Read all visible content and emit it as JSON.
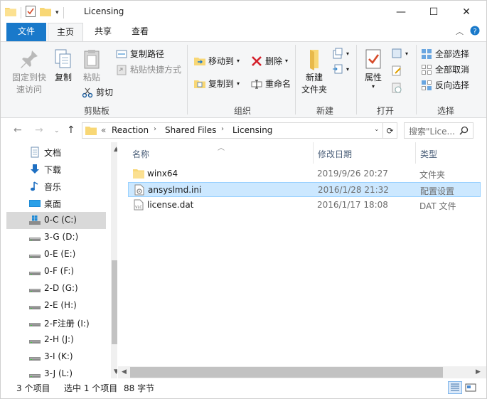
{
  "window": {
    "title": "Licensing",
    "controls": {
      "minimize": "—",
      "maximize": "☐",
      "close": "✕"
    }
  },
  "ribbon_tabs": [
    {
      "label": "文件"
    },
    {
      "label": "主页"
    },
    {
      "label": "共享"
    },
    {
      "label": "查看"
    }
  ],
  "ribbon": {
    "clipboard": {
      "pin_label": "固定到快\n速访问",
      "copy_label": "复制",
      "paste_label": "粘贴",
      "copy_path_label": "复制路径",
      "paste_shortcut_label": "粘贴快捷方式",
      "cut_label": "剪切",
      "group_label": "剪贴板"
    },
    "organize": {
      "move_to_label": "移动到",
      "copy_to_label": "复制到",
      "delete_label": "删除",
      "rename_label": "重命名",
      "group_label": "组织"
    },
    "new": {
      "new_folder_label": "新建\n文件夹",
      "group_label": "新建"
    },
    "open": {
      "properties_label": "属性",
      "group_label": "打开"
    },
    "select": {
      "select_all_label": "全部选择",
      "select_none_label": "全部取消",
      "invert_label": "反向选择",
      "group_label": "选择"
    }
  },
  "address": {
    "prefix": "«",
    "crumbs": [
      "Reaction",
      "Shared Files",
      "Licensing"
    ],
    "search_placeholder": "搜索\"Lice..."
  },
  "nav_pane": {
    "items": [
      {
        "label": "文档",
        "icon": "documents-icon"
      },
      {
        "label": "下载",
        "icon": "download-icon"
      },
      {
        "label": "音乐",
        "icon": "music-icon"
      },
      {
        "label": "桌面",
        "icon": "desktop-icon"
      },
      {
        "label": "0-C (C:)",
        "icon": "windows-drive-icon",
        "selected": true
      },
      {
        "label": "3-G (D:)",
        "icon": "drive-icon"
      },
      {
        "label": "0-E (E:)",
        "icon": "drive-icon"
      },
      {
        "label": "0-F (F:)",
        "icon": "drive-icon"
      },
      {
        "label": "2-D (G:)",
        "icon": "drive-icon"
      },
      {
        "label": "2-E (H:)",
        "icon": "drive-icon"
      },
      {
        "label": "2-F注册 (I:)",
        "icon": "drive-icon"
      },
      {
        "label": "2-H (J:)",
        "icon": "drive-icon"
      },
      {
        "label": "3-I (K:)",
        "icon": "drive-icon"
      },
      {
        "label": "3-J (L:)",
        "icon": "drive-icon"
      }
    ]
  },
  "file_list": {
    "columns": {
      "name": "名称",
      "date": "修改日期",
      "type": "类型"
    },
    "rows": [
      {
        "name": "winx64",
        "date": "2019/9/26 20:27",
        "type": "文件夹",
        "icon": "folder-icon"
      },
      {
        "name": "ansyslmd.ini",
        "date": "2016/1/28 21:32",
        "type": "配置设置",
        "icon": "ini-file-icon",
        "selected": true
      },
      {
        "name": "license.dat",
        "date": "2016/1/17 18:08",
        "type": "DAT 文件",
        "icon": "dat-file-icon"
      }
    ]
  },
  "status": {
    "count": "3 个项目",
    "selection": "选中 1 个项目",
    "size": "88 字节"
  },
  "colors": {
    "accent": "#1979ca",
    "selection_bg": "#cce8ff",
    "selection_border": "#99d1ff",
    "folder": "#f8d775"
  }
}
